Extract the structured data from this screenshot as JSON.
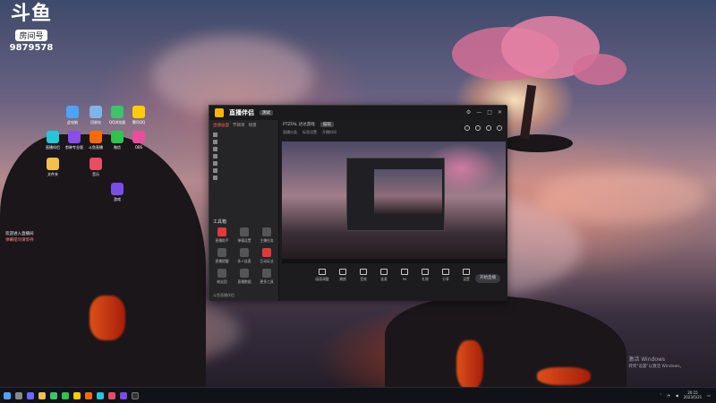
{
  "overlay": {
    "brand": "斗鱼",
    "room_label": "房间号",
    "room_number": "9879578"
  },
  "desktop": {
    "icons": [
      {
        "label": "此电脑",
        "color": "#4aa3ff"
      },
      {
        "label": "回收站",
        "color": "#7fb4e8"
      },
      {
        "label": "QQ浏览器",
        "color": "#3fc36a"
      },
      {
        "label": "腾讯QQ",
        "color": "#ffcc00"
      },
      {
        "label": "直播伴侣",
        "color": "#24c6d8"
      },
      {
        "label": "剪映专业版",
        "color": "#222"
      },
      {
        "label": "斗鱼直播",
        "color": "#ff6a00"
      },
      {
        "label": "微信",
        "color": "#2ec24e"
      },
      {
        "label": "OBS",
        "color": "#333"
      },
      {
        "label": "文件夹",
        "color": "#f2c04b"
      },
      {
        "label": "音乐",
        "color": "#e94d63"
      },
      {
        "label": "游戏",
        "color": "#7a4de8"
      }
    ],
    "side_notes": [
      "欢迎进入直播间",
      "弹幕提问请等待"
    ]
  },
  "app": {
    "title": "直播伴侣",
    "version": "测试",
    "left_tabs": [
      "直播画面",
      "节目单",
      "场景"
    ],
    "tools_title": "工具箱",
    "tools": [
      "直播助手",
      "弹幕设置",
      "主播任务",
      "直播提醒",
      "多人连麦",
      "互动玩法",
      "粉丝团",
      "直播数据",
      "更多工具"
    ],
    "footer": "斗鱼直播伴侣",
    "stream_title": "PTZFAL 达达游戏",
    "stream_pill": "编辑",
    "stream_sub": [
      "直播分类",
      "标签设置",
      "开播时间"
    ],
    "bottom_tools": [
      "画面调整",
      "美颜",
      "音效",
      "连麦",
      "PK",
      "礼物",
      "分享",
      "设置"
    ],
    "start_button": "开始直播"
  },
  "watermark": {
    "line1": "激活 Windows",
    "line2": "转到\"设置\"以激活 Windows。"
  },
  "taskbar": {
    "time": "20:15",
    "date": "2023/5/21"
  }
}
